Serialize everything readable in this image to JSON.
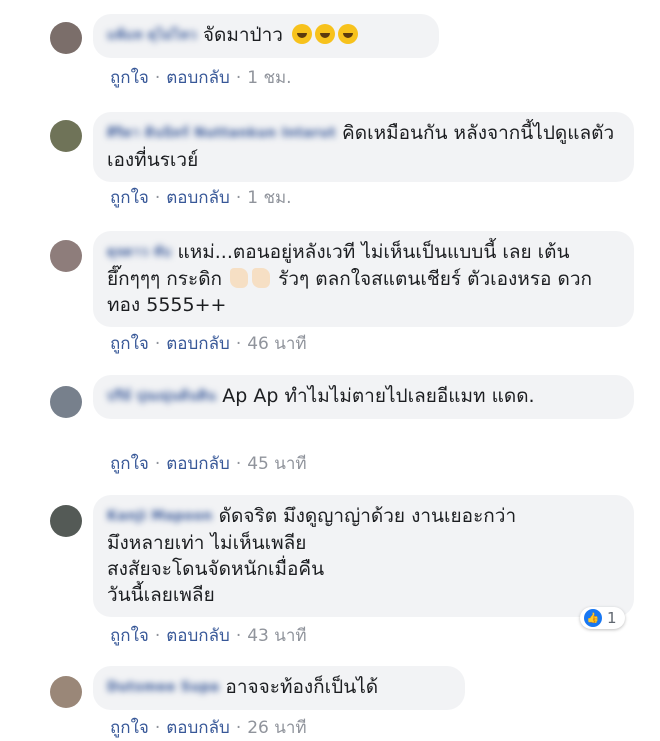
{
  "actions": {
    "like": "ถูกใจ",
    "reply": "ตอบกลับ",
    "dot": "·"
  },
  "comments": [
    {
      "name": "แพ้แท ดุไม่ไหว",
      "text": "จัดมาป่าว",
      "time": "1 ชม."
    },
    {
      "name": "ศิริดา ดินนิทร์ Nuttankun Intarut",
      "text": "คิดเหมือนกัน หลังจากนี้ไปดูแลตัวเองที่นรเวย์",
      "time": "1 ชม."
    },
    {
      "name": "ดุจดาว ทับ",
      "text_a": "แหม่...ตอนอยู่หลังเวที ไม่เห็นเป็นแบบนี้ เลย เต้นยึ๊กๆๆๆ กระดิก",
      "text_b": "รัวๆ ตลกใจสแตนเชียร์ ตัวเองหรอ ดวกทอง 5555++",
      "time": "46 นาที"
    },
    {
      "name": "ปรีย์ ปุณณุ่นต้นติน",
      "text": "Ap Ap ทำไมไม่ตายไปเลยอีแมท แดด.",
      "time": "45 นาที"
    },
    {
      "name": "Kanji Mapoon",
      "text_l1": "ดัดจริต มึงดูญาญ่าด้วย งานเยอะกว่า",
      "text_l2": "มึงหลายเท่า ไม่เห็นเพลีย",
      "text_l3": "สงสัยจะโดนจัดหนักเมื่อคืน",
      "text_l4": "วันนี้เลยเพลีย",
      "time": "43 นาที",
      "reaction_count": "1"
    },
    {
      "name": "Dutsmee Supa",
      "text": "อาจจะท้องก็เป็นได้",
      "time": "26 นาที"
    }
  ],
  "icons": {
    "like_reaction": "like-icon",
    "emoji_grin": "grinning-face-icon",
    "emoji_clap": "clapping-hands-icon"
  },
  "colors": {
    "link": "#385898",
    "bubble": "#f2f3f5",
    "meta": "#90949c",
    "like_blue": "#1877f2"
  }
}
